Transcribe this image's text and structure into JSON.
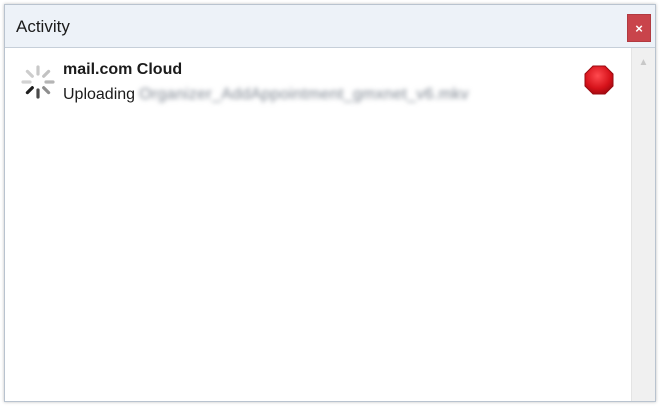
{
  "window": {
    "title": "Activity",
    "close_label": "×"
  },
  "activity": {
    "items": [
      {
        "title": "mail.com Cloud",
        "status": "Uploading",
        "filename": "Organizer_AddAppointment_gmxnet_v6.mkv",
        "icon": "spinner-icon",
        "action_icon": "stop-icon"
      }
    ]
  },
  "colors": {
    "titlebar": "#edf2f8",
    "close_button": "#c9444b",
    "stop_icon": "#d6121a"
  }
}
